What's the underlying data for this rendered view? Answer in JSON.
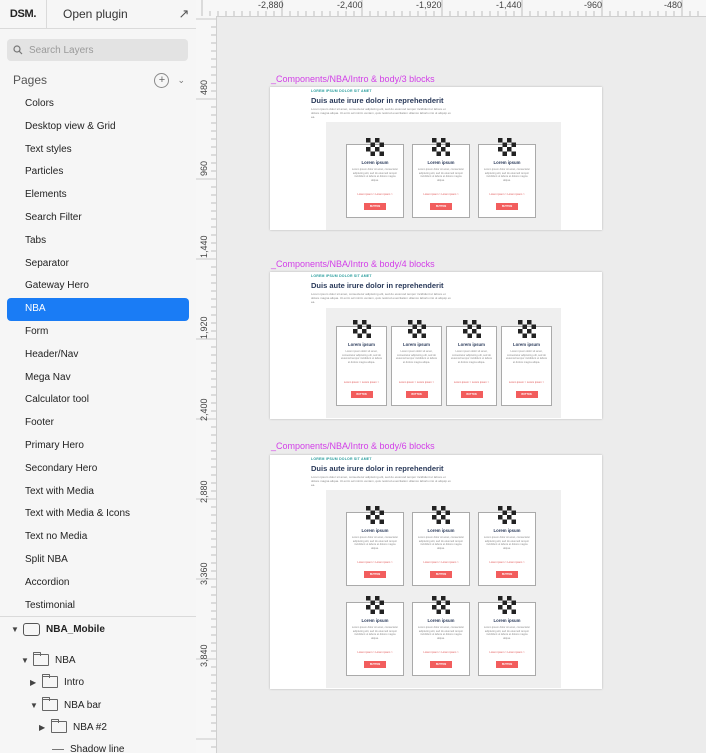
{
  "app": {
    "logo": "DSM.",
    "open_plugin": "Open plugin"
  },
  "search": {
    "placeholder": "Search Layers"
  },
  "pages": {
    "label": "Pages",
    "items": [
      "Colors",
      "Desktop view & Grid",
      "Text styles",
      "Particles",
      "Elements",
      "Search Filter",
      "Tabs",
      "Separator",
      "Gateway Hero",
      "NBA",
      "Form",
      "Header/Nav",
      "Mega Nav",
      "Calculator tool",
      "Footer",
      "Primary Hero",
      "Secondary Hero",
      "Text with Media",
      "Text with Media & Icons",
      "Text no Media",
      "Split NBA",
      "Accordion",
      "Testimonial"
    ],
    "active": "NBA"
  },
  "layers": {
    "symbol": "NBA_Mobile",
    "nba": "NBA",
    "intro": "Intro",
    "nba_bar": "NBA bar",
    "nba2": "NBA #2",
    "shadow_line": "Shadow line"
  },
  "ruler": {
    "top": [
      "-2,880",
      "-2,400",
      "-1,920",
      "-1,440",
      "-960",
      "-480"
    ],
    "left": [
      "480",
      "960",
      "1,440",
      "1,920",
      "2,400",
      "2,880",
      "3,360",
      "3,840"
    ]
  },
  "artboards": [
    {
      "title": "_Components/NBA/Intro & body/3 blocks",
      "blocks": 3
    },
    {
      "title": "_Components/NBA/Intro & body/4 blocks",
      "blocks": 4
    },
    {
      "title": "_Components/NBA/Intro & body/6 blocks",
      "blocks": 6
    }
  ],
  "artboard_content": {
    "eyebrow": "LOREM IPSUM DOLOR SIT AMET",
    "heading": "Duis aute irure dolor in reprehenderit",
    "body": "Lorem ipsum dolor sit amet, consectetur adipiscing elit, sed do eiusmod tempor incididunt ut labore et dolore magna aliqua. Ut enim ad minim veniam, quis nostrud exercitation ullamco laboris nisi ut aliquip ex ea.",
    "card_title": "Lorem ipsum",
    "card_text": "Lorem ipsum dolor sit amet, consectetur adipiscing elit, sed do eiusmod tempor incididunt ut labore et dolore magna aliqua.",
    "card_links": "Lorem ipsum >   Lorem ipsum >",
    "card_button": "BUTTON"
  }
}
